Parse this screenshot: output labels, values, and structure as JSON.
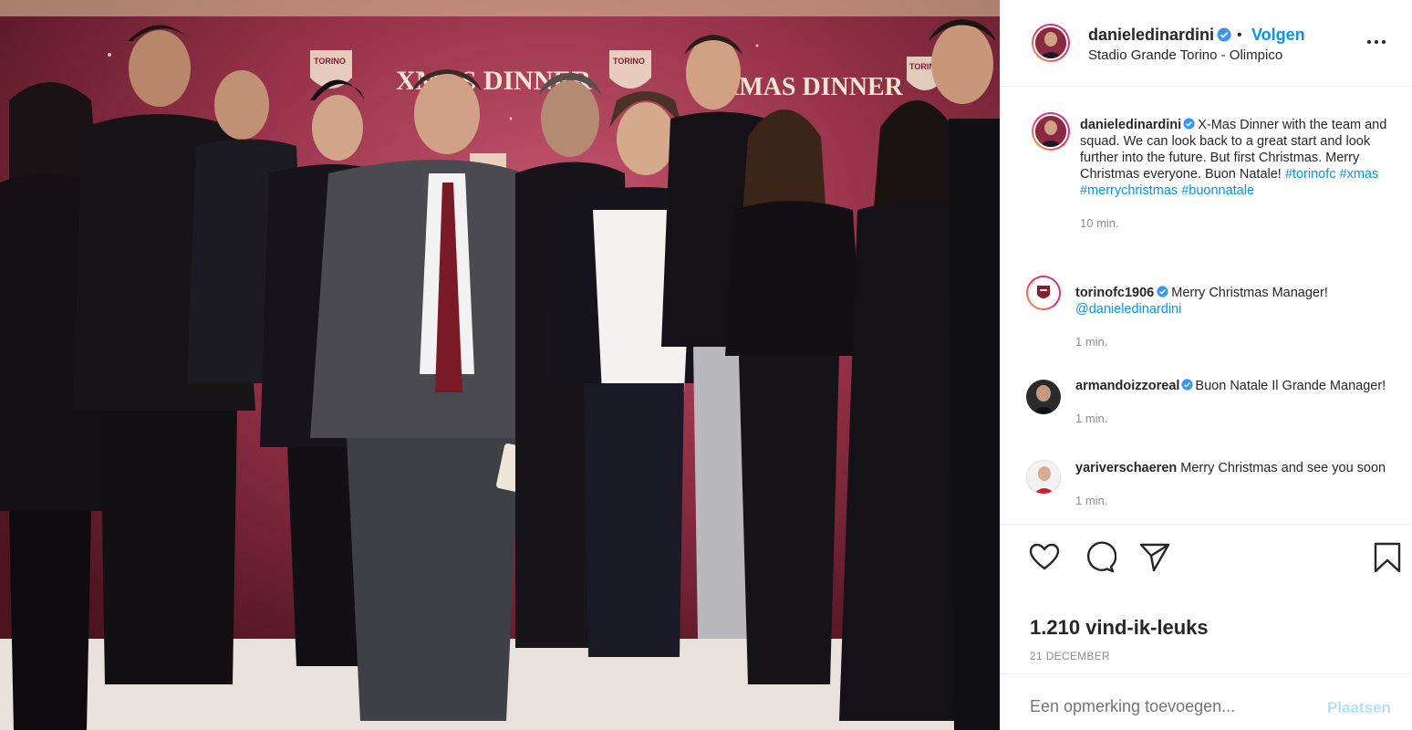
{
  "post": {
    "username": "danieledinardini",
    "follow_label": "Volgen",
    "separator": "•",
    "location": "Stadio Grande Torino - Olimpico",
    "caption_user": "danieledinardini",
    "caption_text": "X-Mas Dinner with the team and squad. We can look back to a great start and look further into the future. But first Christmas. Merry Christmas everyone. Buon Natale!",
    "caption_tags": [
      "#torinofc",
      "#xmas",
      "#merrychristmas",
      "#buonnatale"
    ],
    "caption_time": "10 min.",
    "likes": "1.210 vind-ik-leuks",
    "date": "21 DECEMBER"
  },
  "photo": {
    "backdrop_texts": [
      "XMAS DINNER",
      "XMAS DINNER",
      "TORINO",
      "TORINO",
      "TORINO"
    ]
  },
  "comments": [
    {
      "user": "torinofc1906",
      "verified": true,
      "text": "Merry Christmas Manager!",
      "mention": "@danieledinardini",
      "time": "1 min."
    },
    {
      "user": "armandoizzoreal",
      "verified": true,
      "text": "Buon Natale Il Grande Manager!",
      "mention": "",
      "time": "1 min."
    },
    {
      "user": "yariverschaeren",
      "verified": false,
      "text": "Merry Christmas and see you soon",
      "mention": "",
      "time": "1 min."
    }
  ],
  "add_comment": {
    "placeholder": "Een opmerking toevoegen...",
    "submit_label": "Plaatsen"
  },
  "icons": {
    "verified": "verified-badge-icon",
    "more": "more-options-icon",
    "like": "heart-icon",
    "comment": "comment-bubble-icon",
    "share": "paper-plane-icon",
    "save": "bookmark-icon"
  },
  "colors": {
    "link": "#0095f6",
    "muted": "#8e8e8e",
    "post_disabled": "#b2dffc",
    "backdrop": "#8a2a40"
  }
}
